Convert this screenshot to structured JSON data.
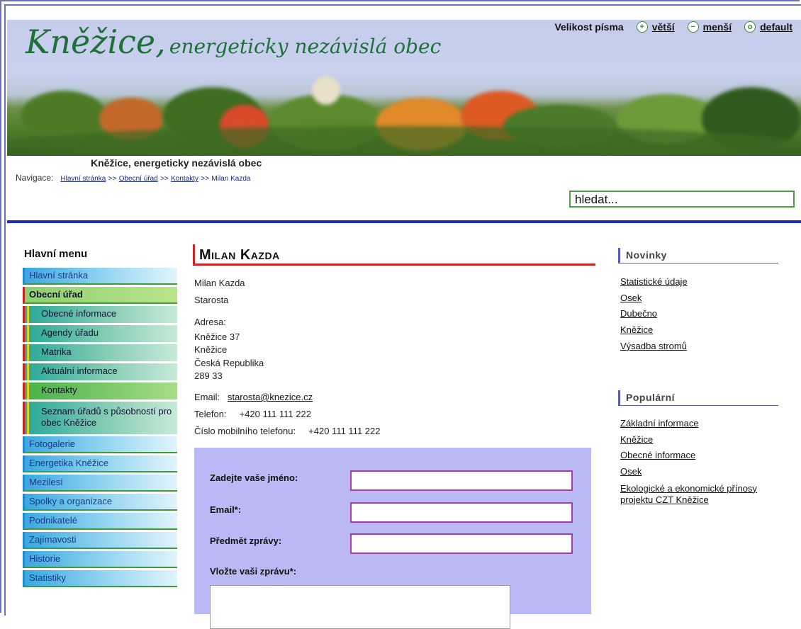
{
  "header": {
    "site_title_big": "Kněžice,",
    "site_title_small": "energeticky nezávislá obec",
    "subtitle": "Kněžice, energeticky nezávislá obec",
    "font_size_label": "Velikost písma",
    "bigger": "větší",
    "smaller": "menší",
    "default": "default",
    "accent_color": "#1f6f3a"
  },
  "breadcrumb": {
    "label": "Navigace:",
    "items": [
      "Hlavní stránka",
      "Obecní úřad",
      "Kontakty"
    ],
    "separator": ">>",
    "current": "Milan Kazda"
  },
  "search": {
    "placeholder": "hledat..."
  },
  "menu": {
    "title": "Hlavní menu",
    "items": [
      "Hlavní stránka",
      "Obecní úřad",
      "Obecné informace",
      "Agendy úřadu",
      "Matrika",
      "Aktuální informace",
      "Kontakty",
      "Seznam úřadů s působností pro obec Kněžice",
      "Fotogalerie",
      "Energetika Kněžice",
      "Mezilesí",
      "Spolky a organizace",
      "Podnikatelé",
      "Zajímavosti",
      "Historie",
      "Statistiky"
    ]
  },
  "main": {
    "title": "Milan Kazda",
    "name": "Milan Kazda",
    "role": "Starosta",
    "address_label": "Adresa:",
    "address": [
      "Kněžice 37",
      "Kněžice",
      "Česká Republika",
      "289 33"
    ],
    "email_label": "Email:",
    "email": "starosta@knezice.cz",
    "phone_label": "Telefon:",
    "phone": "+420 111 111 222",
    "mobile_label": "Číslo mobilního telefonu:",
    "mobile": "+420 111 111 222"
  },
  "form": {
    "name_label": "Zadejte vaše jméno:",
    "email_label": "Email*:",
    "subject_label": "Předmět zprávy:",
    "message_label": "Vložte vaši zprávu*:"
  },
  "news": {
    "title": "Novinky",
    "links": [
      "Statistické údaje",
      "Osek",
      "Dubečno",
      "Kněžice",
      "Výsadba stromů"
    ]
  },
  "popular": {
    "title": "Populární",
    "links": [
      "Základní informace",
      "Kněžice",
      "Obecné informace",
      "Osek",
      "Ekologické a ekonomické přínosy projektu CZT Kněžice"
    ]
  }
}
